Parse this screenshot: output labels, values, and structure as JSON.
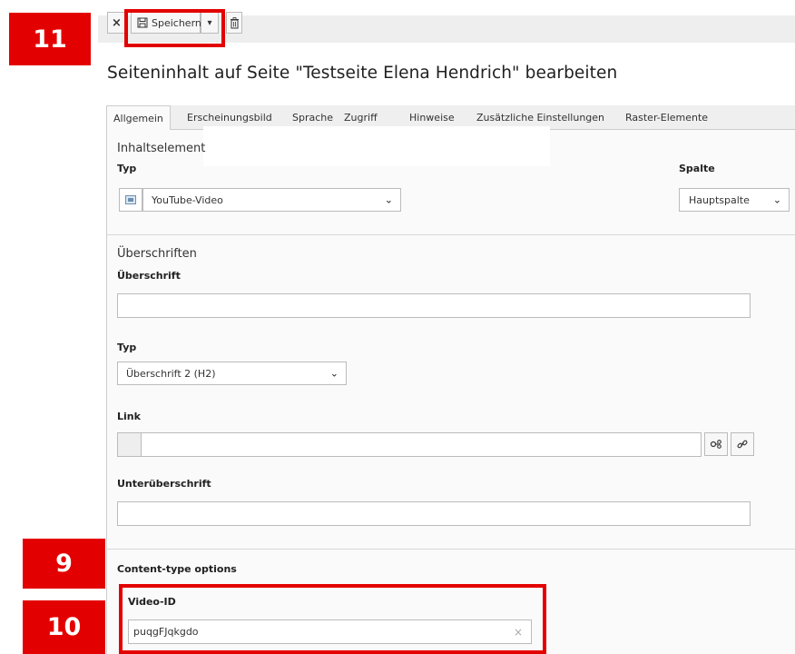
{
  "markers": {
    "m11": "11",
    "m9": "9",
    "m10": "10"
  },
  "toolbar": {
    "close_symbol": "×",
    "save_label": "Speichern",
    "save_dropdown_symbol": "▾",
    "delete_symbol": "🗑"
  },
  "page": {
    "title": "Seiteninhalt auf Seite \"Testseite Elena Hendrich\" bearbeiten"
  },
  "tabs": [
    {
      "label": "Allgemein",
      "active": true
    },
    {
      "label": "Erscheinungsbild",
      "active": false
    },
    {
      "label": "Sprache",
      "active": false
    },
    {
      "label": "Zugriff",
      "active": false
    },
    {
      "label": "Hinweise",
      "active": false
    },
    {
      "label": "Zusätzliche Einstellungen",
      "active": false
    },
    {
      "label": "Raster-Elemente",
      "active": false
    }
  ],
  "content_element": {
    "section_title": "Inhaltselement",
    "type_label": "Typ",
    "type_value": "YouTube-Video",
    "column_label": "Spalte",
    "column_value": "Hauptspalte"
  },
  "headlines": {
    "section_title": "Überschriften",
    "headline_label": "Überschrift",
    "headline_value": "",
    "type_label": "Typ",
    "type_value": "Überschrift 2 (H2)",
    "link_label": "Link",
    "link_value": "",
    "subheadline_label": "Unterüberschrift",
    "subheadline_value": ""
  },
  "content_type": {
    "section_title": "Content-type options",
    "video_id_label": "Video-ID",
    "video_id_value": "puqgFJqkgdo",
    "clear_symbol": "×"
  }
}
